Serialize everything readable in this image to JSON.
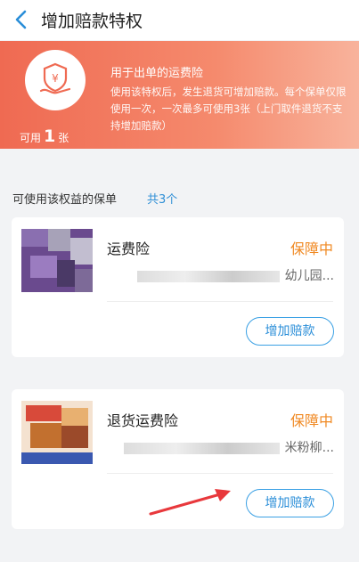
{
  "header": {
    "title": "增加赔款特权"
  },
  "banner": {
    "available_prefix": "可用",
    "available_count": "1",
    "available_suffix": "张",
    "title": "用于出单的运费险",
    "description": "使用该特权后，发生退货可增加赔款。每个保单仅限使用一次，一次最多可使用3张（上门取件退货不支持增加赔款）"
  },
  "section": {
    "label": "可使用该权益的保单",
    "total": "共3个"
  },
  "policies": [
    {
      "name": "运费险",
      "status": "保障中",
      "subtitle": "幼儿园...",
      "button": "增加赔款"
    },
    {
      "name": "退货运费险",
      "status": "保障中",
      "subtitle": "米粉柳...",
      "button": "增加赔款"
    }
  ],
  "colors": {
    "accent": "#ef6a52",
    "status": "#f08a24",
    "link": "#2a8ed8"
  }
}
